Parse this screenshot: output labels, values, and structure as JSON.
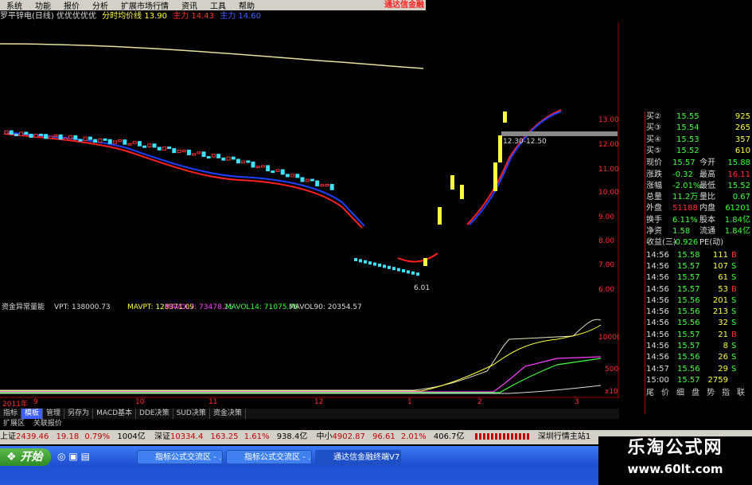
{
  "menu": [
    "系统",
    "功能",
    "报价",
    "分析",
    "扩展市场行情",
    "资讯",
    "工具",
    "帮助"
  ],
  "brand_title": "通达信金融",
  "header": {
    "stock": "罗平锌电(日线)",
    "note": "优优优优优",
    "avg_label": "分时均价线",
    "avg_val": "13.90",
    "main_label": "主力",
    "main_val": "14.43",
    "main2_label": "主力",
    "main2_val": "14.60"
  },
  "main_chart": {
    "price_axis": [
      "13.00",
      "12.00",
      "11.00",
      "10.00",
      "9.00",
      "8.00",
      "7.00",
      "6.00"
    ],
    "annotation_high": "12.30-12.50",
    "annotation_low": "6.01",
    "colors": {
      "up": "#ff3030",
      "down": "#40e0ff",
      "ma1": "#ff2020",
      "ma2": "#2040ff",
      "yellow": "#ffff40",
      "long_ma": "#e8e0a0"
    }
  },
  "volume_chart": {
    "title": "资金异常量能",
    "vpt": "VPT: 138000.73",
    "mavpt": "MAVPT: 128371.09",
    "mavol7": "MAVOL7: 73478.25",
    "mavol14": "MAVOL14: 71075.76",
    "mavol90": "MAVOL90: 20354.57",
    "axis": [
      "10000",
      "5000",
      "x10"
    ],
    "dates": [
      "2011年",
      "9",
      "10",
      "11",
      "12",
      "1",
      "2",
      "3"
    ]
  },
  "tabs": [
    "指标",
    "模板",
    "管理",
    "另存为",
    "MACD基本",
    "DDE决策",
    "SUD决策",
    "资金决策"
  ],
  "subtabs": [
    "扩展区",
    "关联报价"
  ],
  "right_panel": {
    "buy": [
      {
        "label": "买②",
        "price": "15.55",
        "vol": "925"
      },
      {
        "label": "买③",
        "price": "15.54",
        "vol": "265"
      },
      {
        "label": "买④",
        "price": "15.53",
        "vol": "357"
      },
      {
        "label": "买⑤",
        "price": "15.52",
        "vol": "610"
      }
    ],
    "stats": [
      [
        "现价",
        "15.57",
        "今开",
        "15.88"
      ],
      [
        "涨跌",
        "-0.32",
        "最高",
        "16.11"
      ],
      [
        "涨幅",
        "-2.01%",
        "最低",
        "15.52"
      ],
      [
        "总量",
        "11.2万",
        "量比",
        "0.67"
      ],
      [
        "外盘",
        "51188",
        "内盘",
        "61201"
      ],
      [
        "换手",
        "6.11%",
        "股本",
        "1.84亿"
      ],
      [
        "净资",
        "1.58",
        "流通",
        "1.84亿"
      ],
      [
        "收益(三)",
        "-0.926",
        "PE(动)",
        ""
      ]
    ],
    "ticks": [
      [
        "14:56",
        "15.58",
        "111",
        "B"
      ],
      [
        "14:56",
        "15.57",
        "107",
        "S"
      ],
      [
        "14:56",
        "15.57",
        "61",
        "S"
      ],
      [
        "14:56",
        "15.57",
        "53",
        "B"
      ],
      [
        "14:56",
        "15.56",
        "201",
        "S"
      ],
      [
        "14:56",
        "15.56",
        "213",
        "S"
      ],
      [
        "14:56",
        "15.56",
        "32",
        "S"
      ],
      [
        "14:56",
        "15.57",
        "21",
        "B"
      ],
      [
        "14:56",
        "15.57",
        "8",
        "S"
      ],
      [
        "14:56",
        "15.56",
        "26",
        "S"
      ],
      [
        "14:57",
        "15.56",
        "29",
        "S"
      ],
      [
        "15:00",
        "15.57",
        "2759",
        ""
      ]
    ],
    "bottom_tabs": [
      "尾",
      "价",
      "细",
      "盘",
      "势",
      "指",
      "联"
    ]
  },
  "status": {
    "sh_label": "上证",
    "sh_val": "2439.46",
    "sh_chg": "19.18",
    "sh_pct": "0.79%",
    "sh_amt": "1004亿",
    "sz_label": "深证",
    "sz_val": "10334.4",
    "sz_chg": "163.25",
    "sz_pct": "1.61%",
    "sz_amt": "938.4亿",
    "zx_label": "中小",
    "zx_val": "4902.87",
    "zx_chg": "96.61",
    "zx_pct": "2.01%",
    "zx_amt": "406.7亿",
    "server": "深圳行情主站1"
  },
  "taskbar": {
    "start": "开始",
    "tasks": [
      "指标公式交流区 - ...",
      "指标公式交流区 - ...",
      "通达信金融终端V7..."
    ]
  },
  "watermark": {
    "line1": "乐淘公式网",
    "line2": "www.60lt.com"
  }
}
